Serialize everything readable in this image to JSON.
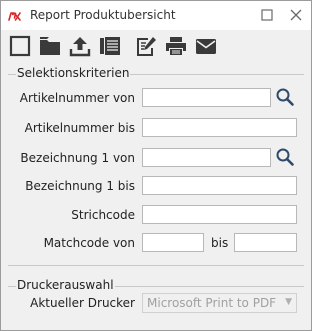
{
  "window": {
    "title": "Report Produktubersicht"
  },
  "toolbar": {
    "icons": [
      "new-document-icon",
      "folder-icon",
      "export-upload-icon",
      "list-report-icon",
      "edit-icon",
      "print-icon",
      "email-icon"
    ]
  },
  "selection": {
    "title": "Selektionskriterien",
    "article_from_label": "Artikelnummer von",
    "article_from_value": "",
    "article_to_label": "Artikelnummer bis",
    "article_to_value": "",
    "desc_from_label": "Bezeichnung 1 von",
    "desc_from_value": "",
    "desc_to_label": "Bezeichnung 1 bis",
    "desc_to_value": "",
    "barcode_label": "Strichcode",
    "barcode_value": "",
    "matchcode_from_label": "Matchcode von",
    "matchcode_from_value": "",
    "matchcode_to_label": "bis",
    "matchcode_to_value": ""
  },
  "printer": {
    "title": "Druckerauswahl",
    "current_label": "Aktueller Drucker",
    "current_value": "Microsoft Print to PDF"
  },
  "colors": {
    "app_icon_red": "#d9262b",
    "icon_dark": "#3a3a3a"
  }
}
